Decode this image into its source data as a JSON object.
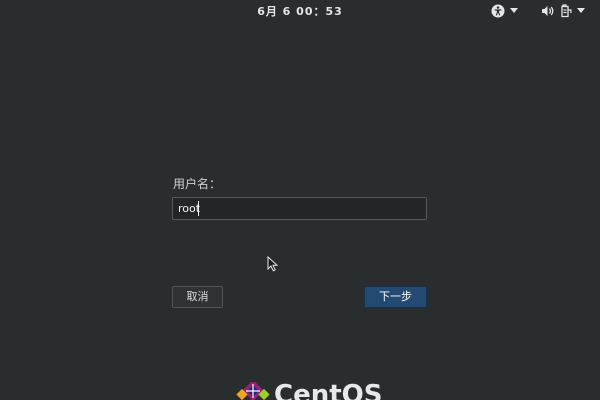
{
  "topbar": {
    "clock": "6月 6 00：53",
    "icons": [
      "accessibility-icon",
      "volume-icon",
      "power-icon"
    ]
  },
  "login": {
    "username_label": "用户名：",
    "username_value": "root",
    "cancel_label": "取消",
    "next_label": "下一步"
  },
  "branding": {
    "logo_text": "CentOS"
  },
  "colors": {
    "background": "#2a2d2e",
    "primary_button": "#234a72"
  }
}
